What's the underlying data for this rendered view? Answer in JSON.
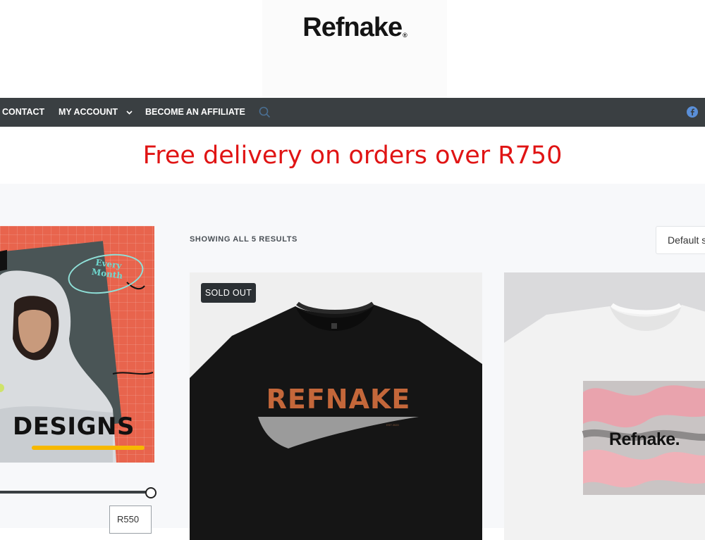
{
  "brand": {
    "logo_text": "Refnake",
    "logo_mark": "®"
  },
  "nav": {
    "items": [
      {
        "label": "CONTACT"
      },
      {
        "label": "MY ACCOUNT"
      },
      {
        "label": "BECOME AN AFFILIATE"
      }
    ],
    "search_icon": "search-icon",
    "social_icon": "facebook-icon"
  },
  "promo": {
    "text": "Free delivery on orders over R750"
  },
  "sidebar": {
    "banner": {
      "tag": "Every Month",
      "headline": "DESIGNS"
    },
    "price_filter": {
      "max_value": "R550"
    }
  },
  "shop": {
    "result_count": "SHOWING ALL 5 RESULTS",
    "sort_label": "Default sorting"
  },
  "products": [
    {
      "badge": "SOLD OUT",
      "print_text": "REFNAKE",
      "print_subtext": "EST 2020"
    },
    {
      "print_text": "Refnake."
    }
  ],
  "colors": {
    "nav_bg": "#3a3f42",
    "promo_red": "#e01414",
    "content_bg": "#f7f8fa",
    "banner_orange": "#e8644d",
    "print_orange": "#c4673a"
  }
}
